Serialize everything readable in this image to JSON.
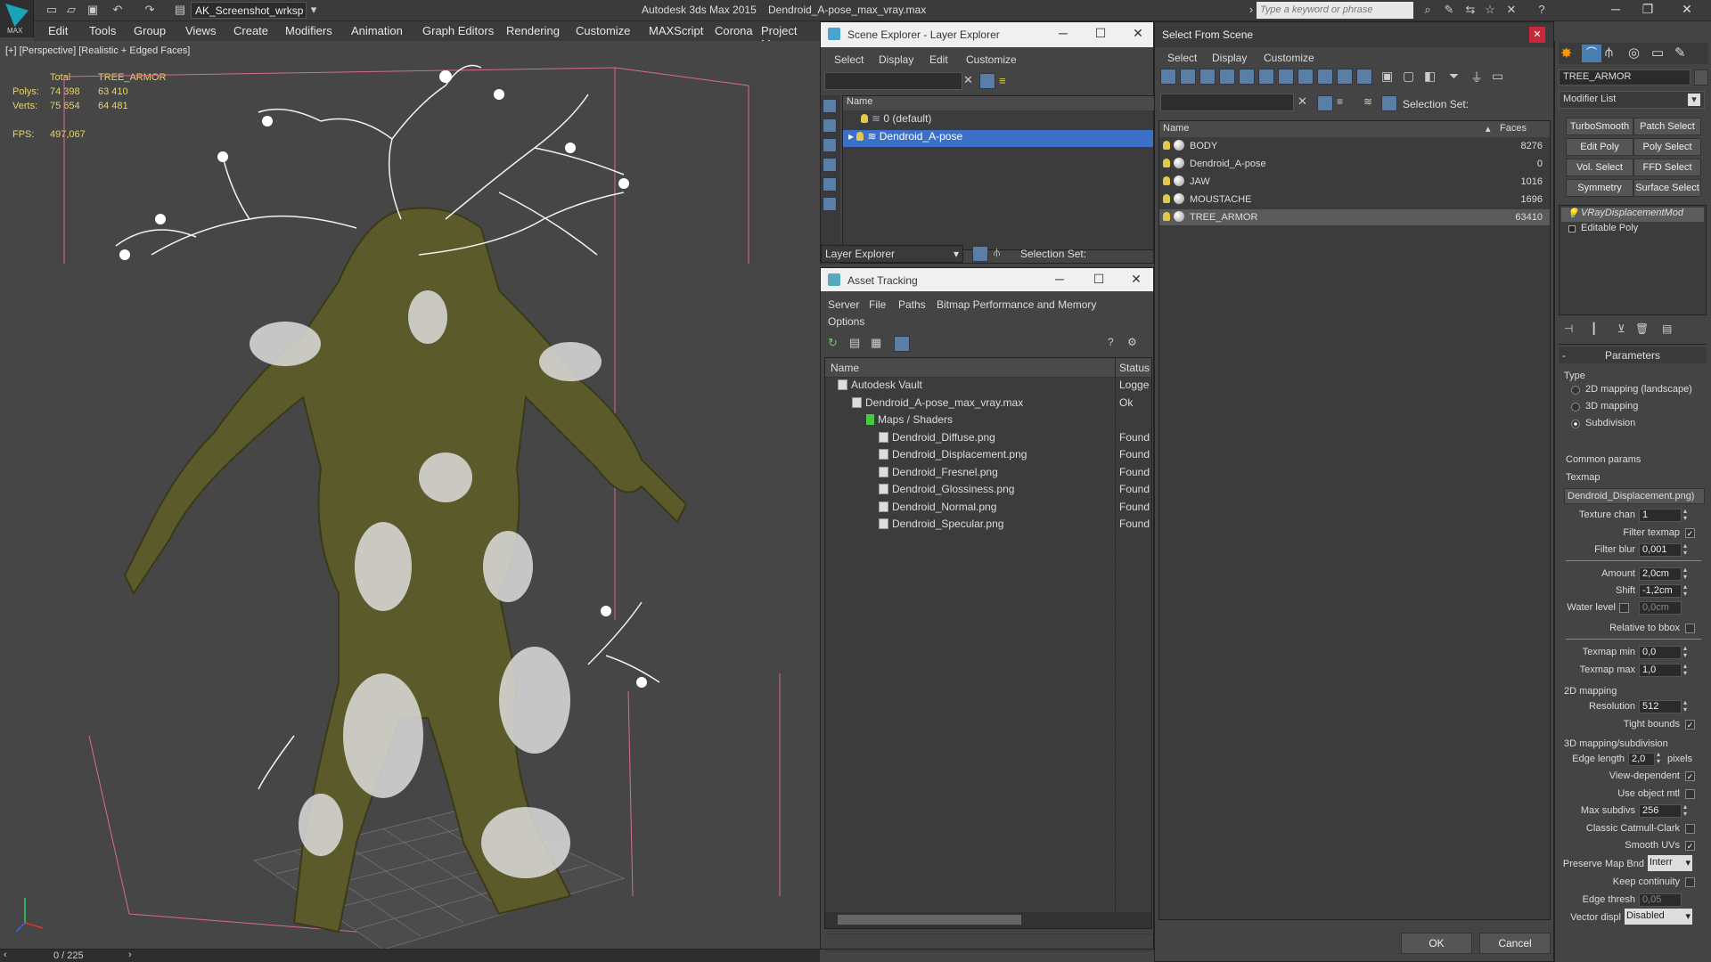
{
  "app": {
    "workspace": "AK_Screenshot_wrksp",
    "title": "Autodesk 3ds Max  2015",
    "file": "Dendroid_A-pose_max_vray.max",
    "search_placeholder": "Type a keyword or phrase",
    "logo_text": "MAX"
  },
  "menu": [
    "Edit",
    "Tools",
    "Group",
    "Views",
    "Create",
    "Modifiers",
    "Animation",
    "Graph Editors",
    "Rendering",
    "Customize",
    "MAXScript",
    "Corona",
    "Project Man"
  ],
  "viewport": {
    "label": "[+] [Perspective] [Realistic + Edged Faces]",
    "stats": {
      "col_total": "Total",
      "col_obj": "TREE_ARMOR",
      "polys_label": "Polys:",
      "polys_total": "74 398",
      "polys_obj": "63 410",
      "verts_label": "Verts:",
      "verts_total": "75 654",
      "verts_obj": "64 481",
      "fps_label": "FPS:",
      "fps_value": "497,067"
    }
  },
  "timeline": {
    "frame": "0 / 225"
  },
  "layer_explorer": {
    "title": "Scene Explorer - Layer Explorer",
    "menu": [
      "Select",
      "Display",
      "Edit",
      "Customize"
    ],
    "col_name": "Name",
    "layers": [
      "0 (default)",
      "Dendroid_A-pose"
    ],
    "footer_dropdown": "Layer Explorer",
    "selection_set": "Selection Set:"
  },
  "asset_tracking": {
    "title": "Asset Tracking",
    "menu": [
      "Server",
      "File",
      "Paths",
      "Bitmap Performance and Memory",
      "Options"
    ],
    "col_name": "Name",
    "col_status": "Status",
    "rows": [
      {
        "name": "Autodesk Vault",
        "status": "Logge"
      },
      {
        "name": "Dendroid_A-pose_max_vray.max",
        "status": "Ok"
      },
      {
        "name": "Maps / Shaders",
        "status": ""
      },
      {
        "name": "Dendroid_Diffuse.png",
        "status": "Found"
      },
      {
        "name": "Dendroid_Displacement.png",
        "status": "Found"
      },
      {
        "name": "Dendroid_Fresnel.png",
        "status": "Found"
      },
      {
        "name": "Dendroid_Glossiness.png",
        "status": "Found"
      },
      {
        "name": "Dendroid_Normal.png",
        "status": "Found"
      },
      {
        "name": "Dendroid_Specular.png",
        "status": "Found"
      }
    ]
  },
  "select_from_scene": {
    "title": "Select From Scene",
    "menu": [
      "Select",
      "Display",
      "Customize"
    ],
    "selection_set": "Selection Set:",
    "col_name": "Name",
    "col_faces": "Faces",
    "rows": [
      {
        "name": "BODY",
        "faces": "8276"
      },
      {
        "name": "Dendroid_A-pose",
        "faces": "0"
      },
      {
        "name": "JAW",
        "faces": "1016"
      },
      {
        "name": "MOUSTACHE",
        "faces": "1696"
      },
      {
        "name": "TREE_ARMOR",
        "faces": "63410"
      }
    ],
    "ok": "OK",
    "cancel": "Cancel"
  },
  "command_panel": {
    "object_name": "TREE_ARMOR",
    "modifier_list": "Modifier List",
    "buttons": [
      "TurboSmooth",
      "Patch Select",
      "Edit Poly",
      "Poly Select",
      "Vol. Select",
      "FFD Select",
      "Symmetry",
      "Surface Select"
    ],
    "stack": [
      "VRayDisplacementMod",
      "Editable Poly"
    ],
    "params_title": "Parameters",
    "type_label": "Type",
    "type_options": [
      "2D mapping (landscape)",
      "3D mapping",
      "Subdivision"
    ],
    "common_label": "Common params",
    "texmap_label": "Texmap",
    "texmap_value": "Dendroid_Displacement.png)",
    "texture_chan_label": "Texture chan",
    "texture_chan": "1",
    "filter_texmap_label": "Filter texmap",
    "filter_blur_label": "Filter blur",
    "filter_blur": "0,001",
    "amount_label": "Amount",
    "amount": "2,0cm",
    "shift_label": "Shift",
    "shift": "-1,2cm",
    "water_label": "Water level",
    "water": "0,0cm",
    "relative_label": "Relative to bbox",
    "texmin_label": "Texmap min",
    "texmin": "0,0",
    "texmax_label": "Texmap max",
    "texmax": "1,0",
    "map2d_label": "2D mapping",
    "resolution_label": "Resolution",
    "resolution": "512",
    "tight_label": "Tight bounds",
    "map3d_label": "3D mapping/subdivision",
    "edge_len_label": "Edge length",
    "edge_len": "2,0",
    "pixels_label": "pixels",
    "view_dep_label": "View-dependent",
    "use_mtl_label": "Use object mtl",
    "max_subdivs_label": "Max subdivs",
    "max_subdivs": "256",
    "catmull_label": "Classic Catmull-Clark",
    "smooth_uv_label": "Smooth UVs",
    "preserve_label": "Preserve Map Bnd",
    "preserve_value": "Interr",
    "keep_cont_label": "Keep continuity",
    "edge_thresh_label": "Edge thresh",
    "edge_thresh": "0,05",
    "vector_label": "Vector displ",
    "vector_value": "Disabled"
  }
}
